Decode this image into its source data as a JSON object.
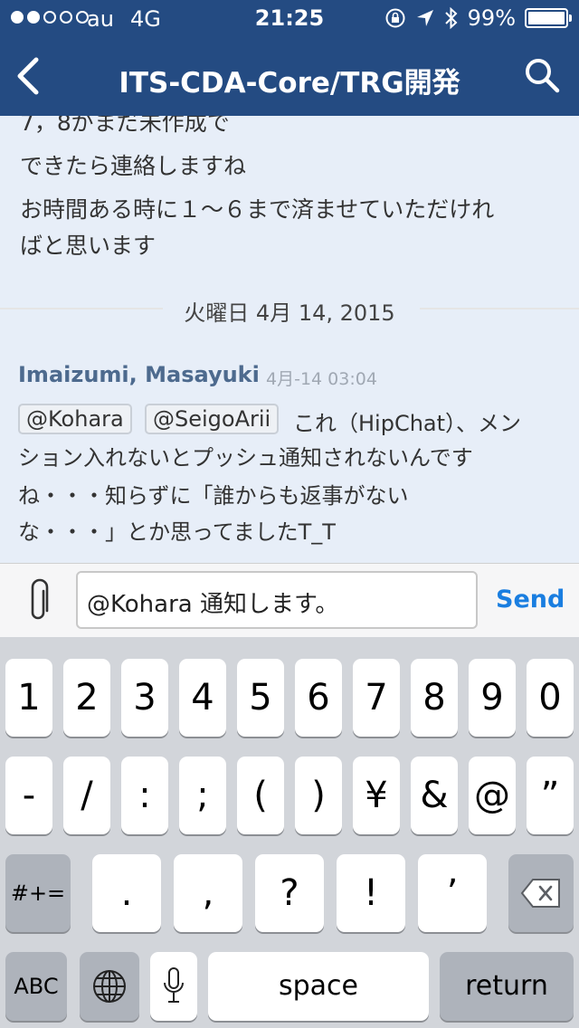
{
  "status_bar": {
    "carrier": "au",
    "network": "4G",
    "time": "21:25",
    "battery": "99%",
    "battery_level": 0.99,
    "signal_bars_filled": 2,
    "signal_bars_total": 5,
    "icons": [
      "rotation-lock-icon",
      "location-icon",
      "bluetooth-icon",
      "battery-icon"
    ]
  },
  "nav": {
    "title": "ITS-CDA-Core/TRG開発",
    "back_icon": "chevron-left-icon",
    "search_icon": "search-icon"
  },
  "messages": {
    "prev_lines": [
      "7，8がまだ未作成で",
      "できたら連絡しますね",
      "お時間ある時に１〜６まで済ませていただけれ",
      "ばと思います"
    ],
    "date_separator": "火曜日 4月 14, 2015",
    "last": {
      "sender": "Imaizumi, Masayuki",
      "time": "4月-14 03:04",
      "mentions": [
        "@Kohara",
        "@SeigoArii"
      ],
      "line1": "これ（HipChat）、メン",
      "lines": [
        "ション入れないとプッシュ通知されないんです",
        "ね・・・知らずに「誰からも返事がない",
        "な・・・」とか思ってましたT_T"
      ]
    }
  },
  "input": {
    "attach_icon": "paperclip-icon",
    "value": "@Kohara 通知します。",
    "send_label": "Send"
  },
  "keyboard": {
    "row1": [
      "1",
      "2",
      "3",
      "4",
      "5",
      "6",
      "7",
      "8",
      "9",
      "0"
    ],
    "row2": [
      "-",
      "/",
      ":",
      ";",
      "(",
      ")",
      "¥",
      "&",
      "@",
      "”"
    ],
    "row3_shift": "#+=",
    "row3": [
      ".",
      ",",
      "?",
      "!",
      "’"
    ],
    "delete_icon": "backspace-icon",
    "abc": "ABC",
    "globe_icon": "globe-icon",
    "mic_icon": "microphone-icon",
    "space": "space",
    "return": "return"
  }
}
